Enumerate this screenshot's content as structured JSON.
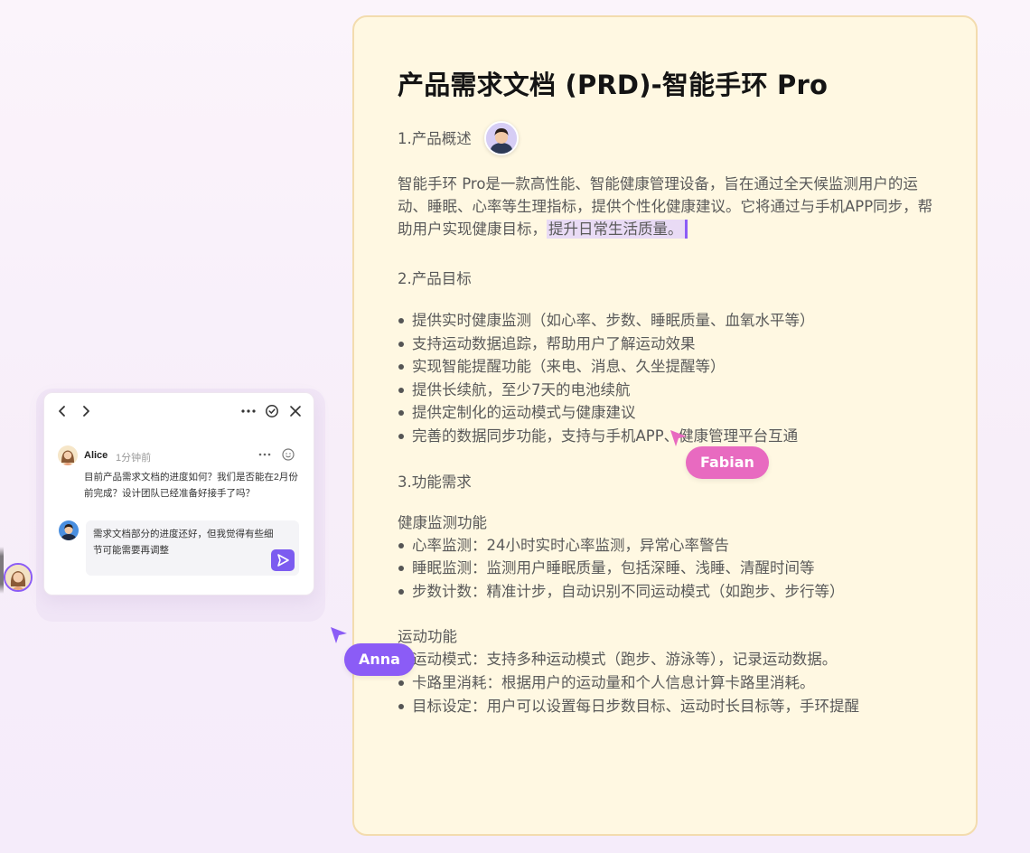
{
  "document": {
    "title": "产品需求文档 (PRD)-智能手环 Pro",
    "sections": [
      {
        "heading": "1.产品概述",
        "paragraph_main": "智能手环 Pro是一款高性能、智能健康管理设备，旨在通过全天候监测用户的运动、睡眠、心率等生理指标，提供个性化健康建议。它将通过与手机APP同步，帮助用户实现健康目标，",
        "paragraph_highlight": "提升日常生活质量。"
      },
      {
        "heading": "2.产品目标",
        "bullets": [
          "提供实时健康监测（如心率、步数、睡眠质量、血氧水平等）",
          "支持运动数据追踪，帮助用户了解运动效果",
          "实现智能提醒功能（来电、消息、久坐提醒等）",
          "提供长续航，至少7天的电池续航",
          "提供定制化的运动模式与健康建议",
          "完善的数据同步功能，支持与手机APP、健康管理平台互通"
        ]
      },
      {
        "heading": "3.功能需求",
        "subsections": [
          {
            "title": "健康监测功能",
            "bullets": [
              "心率监测：24小时实时心率监测，异常心率警告",
              "睡眠监测：监测用户睡眠质量，包括深睡、浅睡、清醒时间等",
              "步数计数：精准计步，自动识别不同运动模式（如跑步、步行等）"
            ]
          },
          {
            "title": "运动功能",
            "bullets": [
              "运动模式：支持多种运动模式（跑步、游泳等），记录运动数据。",
              "卡路里消耗：根据用户的运动量和个人信息计算卡路里消耗。",
              "目标设定：用户可以设置每日步数目标、运动时长目标等，手环提醒"
            ]
          }
        ]
      }
    ]
  },
  "cursors": {
    "fabian": {
      "name": "Fabian",
      "color": "#e86ac0"
    },
    "anna": {
      "name": "Anna",
      "color": "#8b5cf6"
    }
  },
  "comment_panel": {
    "toolbar": {
      "prev_icon": "chevron-left-icon",
      "next_icon": "chevron-right-icon",
      "more_icon": "more-horizontal-icon",
      "resolve_icon": "check-circle-icon",
      "close_icon": "close-icon"
    },
    "thread": {
      "author": "Alice",
      "time": "1分钟前",
      "message": "目前产品需求文档的进度如何？我们是否能在2月份前完成？设计团队已经准备好接手了吗？"
    },
    "reply": {
      "text": "需求文档部分的进度还好，但我觉得有些细节可能需要再调整"
    },
    "accent_color": "#7c5cf0"
  }
}
